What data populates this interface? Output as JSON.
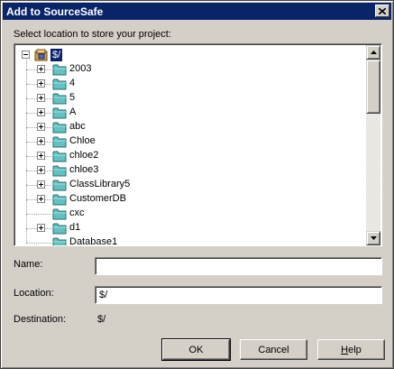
{
  "dialog": {
    "title": "Add to SourceSafe",
    "prompt": "Select location to store your project:"
  },
  "tree": {
    "root": "$/",
    "items": [
      {
        "label": "2003",
        "expandable": true
      },
      {
        "label": "4",
        "expandable": true
      },
      {
        "label": "5",
        "expandable": true
      },
      {
        "label": "A",
        "expandable": true
      },
      {
        "label": "abc",
        "expandable": true
      },
      {
        "label": "Chloe",
        "expandable": true
      },
      {
        "label": "chloe2",
        "expandable": true
      },
      {
        "label": "chloe3",
        "expandable": true
      },
      {
        "label": "ClassLibrary5",
        "expandable": true
      },
      {
        "label": "CustomerDB",
        "expandable": true
      },
      {
        "label": "cxc",
        "expandable": false
      },
      {
        "label": "d1",
        "expandable": true
      },
      {
        "label": "Database1",
        "expandable": false
      }
    ]
  },
  "form": {
    "name_label": "Name:",
    "name_value": "",
    "location_label": "Location:",
    "location_value": "$/",
    "destination_label": "Destination:",
    "destination_value": "$/"
  },
  "buttons": {
    "ok": "OK",
    "cancel": "Cancel",
    "help_prefix": "H",
    "help_rest": "elp"
  },
  "colors": {
    "titlebar": "#0a246a",
    "face": "#d4d0c8",
    "selection": "#0a246a",
    "folder": "#62c2c2"
  }
}
